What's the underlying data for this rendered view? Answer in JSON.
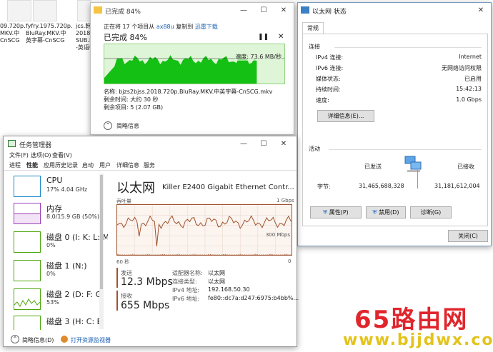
{
  "desktop": {
    "files": [
      {
        "label": "09.720p.\nMKV.中\nCnSCG"
      },
      {
        "label": "fyfry.1975.720p.\nBluRay.MKV.中\n英字幕-CnSCG"
      },
      {
        "label": "jcs.韩\n2018.7\nSUB.H\n-英语中"
      }
    ]
  },
  "copy_dialog": {
    "title": "已完成 84%",
    "copying_prefix": "正在将 17 个项目从",
    "source": "ax88u",
    "copying_mid": "复制到",
    "dest": "迅雷下载",
    "progress_heading": "已完成 84%",
    "progress_percent": 84,
    "speed": "速度: 73.6 MB/秒",
    "name_line": "名称: bjzs2bjss.2018.720p.BluRay.MKV.中英字幕-CnSCG.mkv",
    "time_line": "剩余时间: 大约 30 秒",
    "items_line": "剩余项目: 5 (2.07 GB)",
    "less_details": "简略信息"
  },
  "net_status": {
    "title": "以太网 状态",
    "tab": "常规",
    "section_connection": "连接",
    "rows": [
      {
        "k": "IPv4 连接:",
        "v": "Internet"
      },
      {
        "k": "IPv6 连接:",
        "v": "无网络访问权限"
      },
      {
        "k": "媒体状态:",
        "v": "已启用"
      },
      {
        "k": "持续时间:",
        "v": "15:42:13"
      },
      {
        "k": "速度:",
        "v": "1.0 Gbps"
      }
    ],
    "details_button": "详细信息(E)...",
    "section_activity": "活动",
    "sent_label": "已发送",
    "received_label": "已接收",
    "bytes_label": "字节:",
    "bytes_sent": "31,465,688,328",
    "bytes_received": "31,181,612,004",
    "properties_button": "属性(P)",
    "disable_button": "禁用(D)",
    "diagnose_button": "诊断(G)",
    "close_button": "关闭(C)"
  },
  "task_manager": {
    "title": "任务管理器",
    "menu": [
      "文件(F)",
      "选项(O)",
      "查看(V)"
    ],
    "tabs": [
      "进程",
      "性能",
      "应用历史记录",
      "启动",
      "用户",
      "详细信息",
      "服务"
    ],
    "perf_items": [
      {
        "name": "CPU",
        "sub": "17% 4.04 GHz",
        "color": "#1a87c8"
      },
      {
        "name": "内存",
        "sub": "8.0/15.9 GB (50%)",
        "color": "#9b3fb5"
      },
      {
        "name": "磁盘 0 (I: K: L: M:",
        "sub": "0%",
        "color": "#4da60c"
      },
      {
        "name": "磁盘 1 (N:)",
        "sub": "0%",
        "color": "#4da60c"
      },
      {
        "name": "磁盘 2 (D: F: G:",
        "sub": "53%",
        "color": "#4da60c"
      },
      {
        "name": "磁盘 3 (H: C: E:",
        "sub": "",
        "color": "#4da60c"
      }
    ],
    "adapter_title": "以太网",
    "adapter_name": "Killer E2400 Gigabit Ethernet Contr...",
    "throughput_label": "吞吐量",
    "max_label": "1 Gbps",
    "mid_label": "300 Mbps",
    "time_left": "60 秒",
    "time_right": "0",
    "send_label": "发送",
    "send_value": "12.3 Mbps",
    "recv_label": "接收",
    "recv_value": "655 Mbps",
    "props": [
      {
        "k": "适配器名称:",
        "v": "以太网"
      },
      {
        "k": "连接类型:",
        "v": "以太网"
      },
      {
        "k": "IPv4 地址:",
        "v": "192.168.50.30"
      },
      {
        "k": "IPv6 地址:",
        "v": "fe80::dc7a:d247:6975:b4bb%..."
      }
    ],
    "footer_less": "简略信息(D)",
    "footer_monitor": "打开资源监视器"
  },
  "watermark": {
    "main": "65路由网",
    "sub": "www.bjjdwx.com"
  },
  "colors": {
    "copy_fill": "#13c013",
    "tm_accent": "#a0522d",
    "link": "#1a5fb4"
  }
}
